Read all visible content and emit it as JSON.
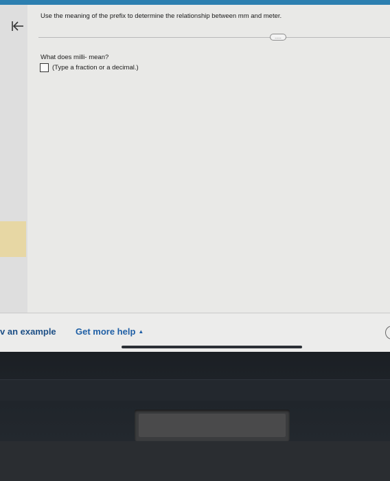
{
  "question": {
    "instruction": "Use the meaning of the prefix to determine the relationship between mm and meter.",
    "more_label": "....."
  },
  "answer": {
    "prompt": "What does milli- mean?",
    "input_value": "",
    "hint": "(Type a fraction or a decimal.)"
  },
  "footer": {
    "example_label": "v an example",
    "help_label": "Get more help"
  },
  "colors": {
    "accent": "#2c7fb0",
    "link": "#1f5fa5",
    "highlight": "#e7d7a4"
  },
  "icons": {
    "back": "back-to-start-icon",
    "caret": "caret-up-icon"
  }
}
